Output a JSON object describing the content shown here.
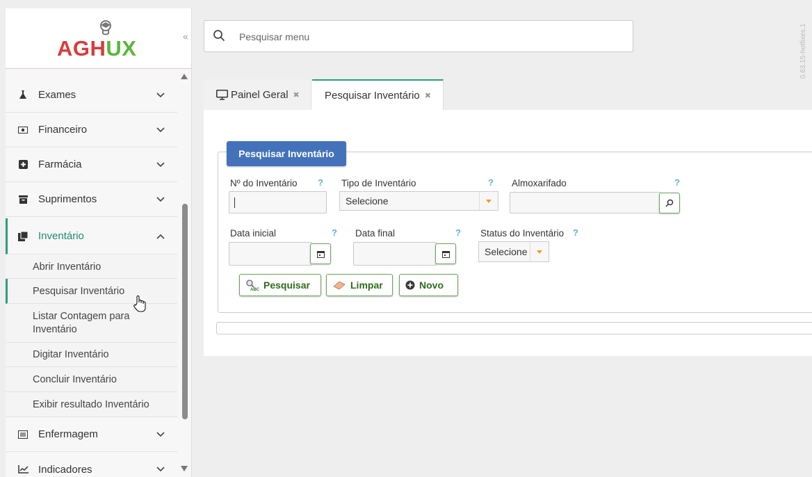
{
  "app": {
    "logo_prefix": "AGH",
    "logo_u": "U",
    "logo_suffix": "X",
    "version": "V. 10.63.15-hotfixes.1",
    "collapse": "«"
  },
  "search": {
    "placeholder": "Pesquisar menu"
  },
  "sidebar": {
    "items": [
      {
        "label": "Exames",
        "icon": "flask-icon"
      },
      {
        "label": "Financeiro",
        "icon": "money-icon"
      },
      {
        "label": "Farmácia",
        "icon": "plus-square-icon"
      },
      {
        "label": "Suprimentos",
        "icon": "archive-icon"
      },
      {
        "label": "Inventário",
        "icon": "clipboard-icon"
      },
      {
        "label": "Enfermagem",
        "icon": "list-icon"
      },
      {
        "label": "Indicadores",
        "icon": "chart-line-icon"
      }
    ],
    "chevron_down": "﹀",
    "chevron_up": "︿",
    "subitems": [
      "Abrir Inventário",
      "Pesquisar Inventário",
      "Listar Contagem para Inventário",
      "Digitar Inventário",
      "Concluir Inventário",
      "Exibir resultado Inventário"
    ]
  },
  "tabs": [
    {
      "label": "Painel Geral",
      "close": "✖"
    },
    {
      "label": "Pesquisar Inventário",
      "close": "✖"
    }
  ],
  "form": {
    "legend": "Pesquisar Inventário",
    "help": "?",
    "labels": {
      "numero": "Nº do Inventário",
      "tipo": "Tipo de Inventário",
      "almox": "Almoxarifado",
      "data_inicial": "Data inicial",
      "data_final": "Data final",
      "status": "Status do Inventário"
    },
    "tipo_value": "Selecione",
    "status_value": "Selecione",
    "buttons": {
      "pesquisar": "Pesquisar",
      "limpar": "Limpar",
      "novo": "Novo"
    }
  },
  "colors": {
    "accent": "#2c9c7e",
    "legend_bg": "#4472ba",
    "button_text": "#2f6b1d",
    "caret": "#f09a1e",
    "help": "#5fb0d8"
  }
}
